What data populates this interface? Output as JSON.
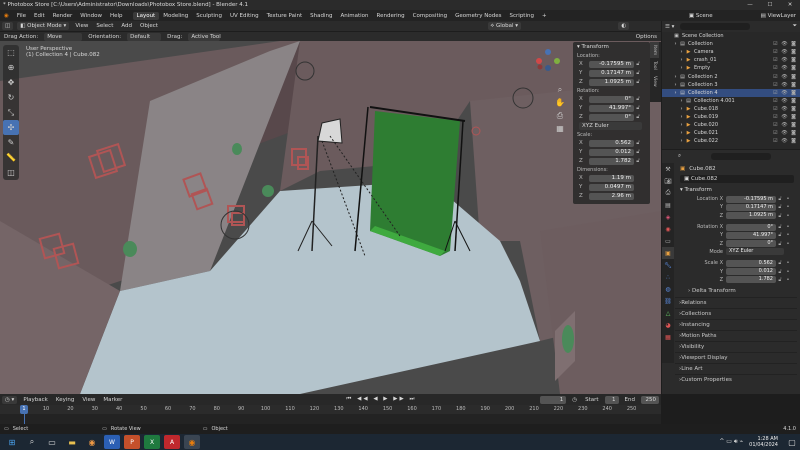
{
  "window": {
    "title": "* Photobox Store [C:\\Users\\Administrator\\Downloads\\Photobox Store.blend] - Blender 4.1"
  },
  "menu": [
    "File",
    "Edit",
    "Render",
    "Window",
    "Help"
  ],
  "workspaces": [
    "Layout",
    "Modeling",
    "Sculpting",
    "UV Editing",
    "Texture Paint",
    "Shading",
    "Animation",
    "Rendering",
    "Compositing",
    "Geometry Nodes",
    "Scripting"
  ],
  "top_right": {
    "scene": "Scene",
    "view_layer": "ViewLayer"
  },
  "viewport_header": {
    "mode": "Object Mode",
    "view": "View",
    "select": "Select",
    "add": "Add",
    "object": "Object",
    "orientation": "Global"
  },
  "tool_header": {
    "drag_action_label": "Drag Action:",
    "drag_action": "Move",
    "orientation_label": "Orientation:",
    "orientation": "Default",
    "drag_label": "Drag:",
    "drag": "Active Tool",
    "options": "Options"
  },
  "viewport_info": {
    "line1": "User Perspective",
    "line2": "(1) Collection 4 | Cube.082"
  },
  "npanel": {
    "tabs": [
      "Item",
      "Tool",
      "View"
    ],
    "header": "Transform",
    "location_label": "Location:",
    "location": [
      {
        "axis": "X",
        "value": "-0.17595 m"
      },
      {
        "axis": "Y",
        "value": "0.17147 m"
      },
      {
        "axis": "Z",
        "value": "1.0925 m"
      }
    ],
    "rotation_label": "Rotation:",
    "rotation": [
      {
        "axis": "X",
        "value": "0°"
      },
      {
        "axis": "Y",
        "value": "41.997°"
      },
      {
        "axis": "Z",
        "value": "0°"
      }
    ],
    "rotation_mode": "XYZ Euler",
    "scale_label": "Scale:",
    "scale": [
      {
        "axis": "X",
        "value": "0.562"
      },
      {
        "axis": "Y",
        "value": "0.012"
      },
      {
        "axis": "Z",
        "value": "1.782"
      }
    ],
    "dimensions_label": "Dimensions:",
    "dimensions": [
      {
        "axis": "X",
        "value": "1.19 m"
      },
      {
        "axis": "Y",
        "value": "0.0497 m"
      },
      {
        "axis": "Z",
        "value": "2.96 m"
      }
    ]
  },
  "outliner": {
    "search_placeholder": "",
    "rows": [
      {
        "label": "Scene Collection",
        "indent": 0,
        "icon": "▣"
      },
      {
        "label": "Collection",
        "indent": 1,
        "icon": "▤"
      },
      {
        "label": "Camera",
        "indent": 2,
        "icon": "▶"
      },
      {
        "label": "crash_01",
        "indent": 2,
        "icon": "▶"
      },
      {
        "label": "Empty",
        "indent": 2,
        "icon": "▶"
      },
      {
        "label": "Collection 2",
        "indent": 1,
        "icon": "▤"
      },
      {
        "label": "Collection 3",
        "indent": 1,
        "icon": "▤"
      },
      {
        "label": "Collection 4",
        "indent": 1,
        "icon": "▤"
      },
      {
        "label": "Collection 4.001",
        "indent": 2,
        "icon": "▤"
      },
      {
        "label": "Cube.018",
        "indent": 2,
        "icon": "▶"
      },
      {
        "label": "Cube.019",
        "indent": 2,
        "icon": "▶"
      },
      {
        "label": "Cube.020",
        "indent": 2,
        "icon": "▶"
      },
      {
        "label": "Cube.021",
        "indent": 2,
        "icon": "▶"
      },
      {
        "label": "Cube.022",
        "indent": 2,
        "icon": "▶"
      }
    ]
  },
  "properties": {
    "object_name": "Cube.082",
    "object_field": "Cube.082",
    "transform_header": "Transform",
    "location_label": "Location X",
    "location": [
      {
        "label": "Location X",
        "value": "-0.17595 m"
      },
      {
        "label": "Y",
        "value": "0.17147 m"
      },
      {
        "label": "Z",
        "value": "1.0925 m"
      }
    ],
    "rotation": [
      {
        "label": "Rotation X",
        "value": "0°"
      },
      {
        "label": "Y",
        "value": "41.997°"
      },
      {
        "label": "Z",
        "value": "0°"
      }
    ],
    "mode_label": "Mode",
    "mode": "XYZ Euler",
    "scale": [
      {
        "label": "Scale X",
        "value": "0.562"
      },
      {
        "label": "Y",
        "value": "0.012"
      },
      {
        "label": "Z",
        "value": "1.782"
      }
    ],
    "delta": "Delta Transform",
    "sections": [
      "Relations",
      "Collections",
      "Instancing",
      "Motion Paths",
      "Visibility",
      "Viewport Display",
      "Line Art",
      "Custom Properties"
    ]
  },
  "timeline": {
    "menus": [
      "Playback",
      "Keying",
      "View",
      "Marker"
    ],
    "current_frame": "1",
    "start_label": "Start",
    "start": "1",
    "end_label": "End",
    "end": "250",
    "ticks": [
      "10",
      "20",
      "30",
      "40",
      "50",
      "60",
      "70",
      "80",
      "90",
      "100",
      "110",
      "120",
      "130",
      "140",
      "150",
      "160",
      "170",
      "180",
      "190",
      "200",
      "210",
      "220",
      "230",
      "240",
      "250"
    ],
    "cur": "1"
  },
  "statusbar": {
    "select": "Select",
    "rotate": "Rotate View",
    "object": "Object",
    "version": "4.1.0"
  },
  "taskbar": {
    "time": "1:28 AM",
    "date": "01/04/2024"
  },
  "colors": {
    "accent": "#4772b3",
    "backdrop_green": "#2e7d32",
    "wall": "#6e5f61",
    "floor": "#b4c4cc"
  }
}
